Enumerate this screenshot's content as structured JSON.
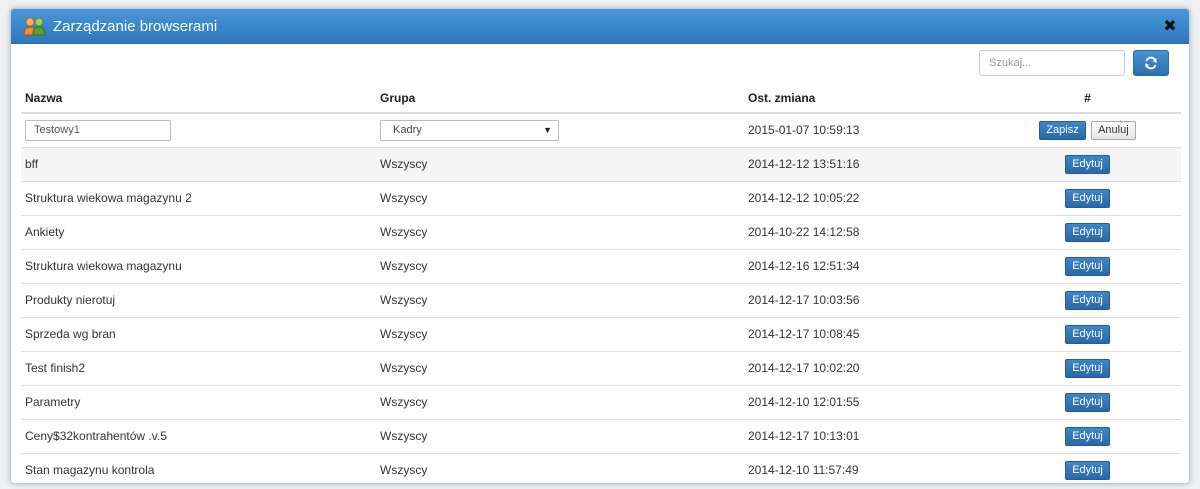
{
  "window": {
    "title": "Zarządzanie browserami",
    "close_symbol": "✖"
  },
  "toolbar": {
    "search_placeholder": "Szukaj..."
  },
  "table": {
    "headers": {
      "name": "Nazwa",
      "group": "Grupa",
      "modified": "Ost. zmiana",
      "actions": "#"
    },
    "edit_row": {
      "name_value": "Testowy1",
      "group_value": "Kadry",
      "modified": "2015-01-07 10:59:13",
      "save_label": "Zapisz",
      "cancel_label": "Anuluj"
    },
    "edit_label": "Edytuj",
    "rows": [
      {
        "name": "bff",
        "group": "Wszyscy",
        "modified": "2014-12-12 13:51:16"
      },
      {
        "name": "Struktura wiekowa magazynu 2",
        "group": "Wszyscy",
        "modified": "2014-12-12 10:05:22"
      },
      {
        "name": "Ankiety",
        "group": "Wszyscy",
        "modified": "2014-10-22 14:12:58"
      },
      {
        "name": "Struktura wiekowa magazynu",
        "group": "Wszyscy",
        "modified": "2014-12-16 12:51:34"
      },
      {
        "name": "Produkty nierotuj",
        "group": "Wszyscy",
        "modified": "2014-12-17 10:03:56"
      },
      {
        "name": "Sprzeda wg bran",
        "group": "Wszyscy",
        "modified": "2014-12-17 10:08:45"
      },
      {
        "name": "Test finish2",
        "group": "Wszyscy",
        "modified": "2014-12-17 10:02:20"
      },
      {
        "name": "Parametry",
        "group": "Wszyscy",
        "modified": "2014-12-10 12:01:55"
      },
      {
        "name": "Ceny$32kontrahentów .v.5",
        "group": "Wszyscy",
        "modified": "2014-12-17 10:13:01"
      },
      {
        "name": "Stan magazynu kontrola",
        "group": "Wszyscy",
        "modified": "2014-12-10 11:57:49"
      }
    ]
  },
  "colors": {
    "accent": "#2f78be",
    "button_primary": "#2a67a8"
  }
}
